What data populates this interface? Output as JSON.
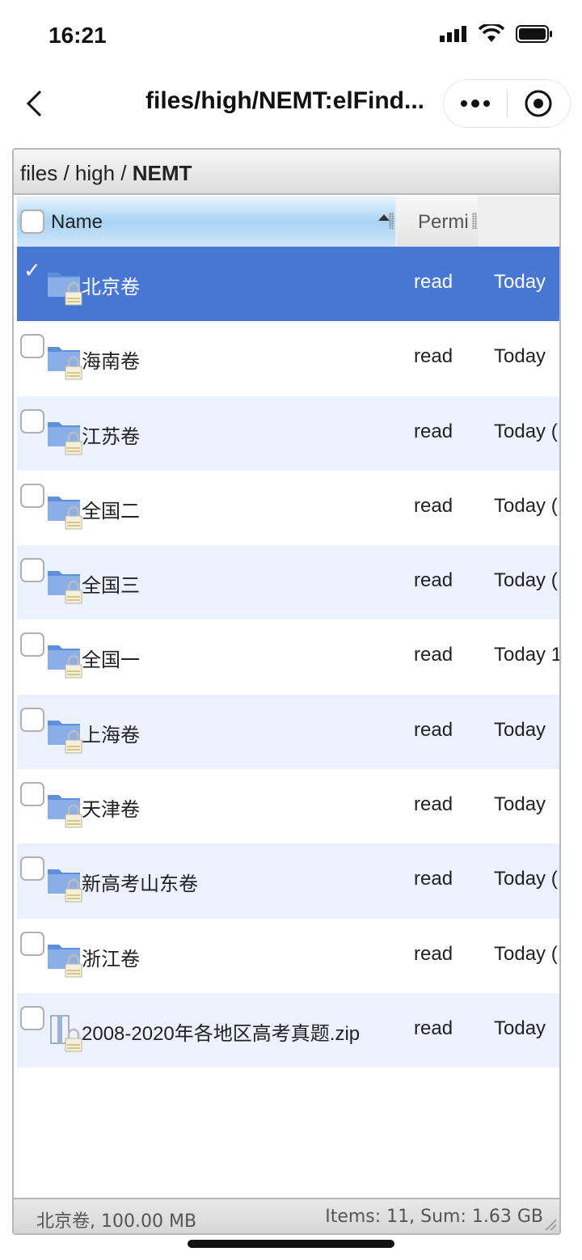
{
  "status_bar": {
    "time": "16:21"
  },
  "nav": {
    "title": "files/high/NEMT:elFind..."
  },
  "path": {
    "seg1": "files",
    "sep1": " / ",
    "seg2": "high",
    "sep2": " / ",
    "current": "NEMT"
  },
  "columns": {
    "name": "Name",
    "perm": "Permi"
  },
  "rows": [
    {
      "name": "北京卷",
      "perm": "read",
      "date": "Today",
      "type": "folder",
      "selected": true
    },
    {
      "name": "海南卷",
      "perm": "read",
      "date": "Today",
      "type": "folder",
      "selected": false
    },
    {
      "name": "江苏卷",
      "perm": "read",
      "date": "Today (",
      "type": "folder",
      "selected": false
    },
    {
      "name": "全国二",
      "perm": "read",
      "date": "Today (",
      "type": "folder",
      "selected": false
    },
    {
      "name": "全国三",
      "perm": "read",
      "date": "Today (",
      "type": "folder",
      "selected": false
    },
    {
      "name": "全国一",
      "perm": "read",
      "date": "Today 1",
      "type": "folder",
      "selected": false
    },
    {
      "name": "上海卷",
      "perm": "read",
      "date": "Today",
      "type": "folder",
      "selected": false
    },
    {
      "name": "天津卷",
      "perm": "read",
      "date": "Today",
      "type": "folder",
      "selected": false
    },
    {
      "name": "新高考山东卷",
      "perm": "read",
      "date": "Today (",
      "type": "folder",
      "selected": false
    },
    {
      "name": "浙江卷",
      "perm": "read",
      "date": "Today (",
      "type": "folder",
      "selected": false
    },
    {
      "name": "2008-2020年各地区高考真题.zip",
      "perm": "read",
      "date": "Today",
      "type": "zip",
      "selected": false
    }
  ],
  "footer": {
    "selection": "北京卷, 100.00 MB",
    "summary": "Items: 11, Sum: 1.63 GB"
  },
  "colors": {
    "selected_row": "#4876d3",
    "alt_row": "#ebf2fd",
    "folder": "#5f8fdc"
  }
}
